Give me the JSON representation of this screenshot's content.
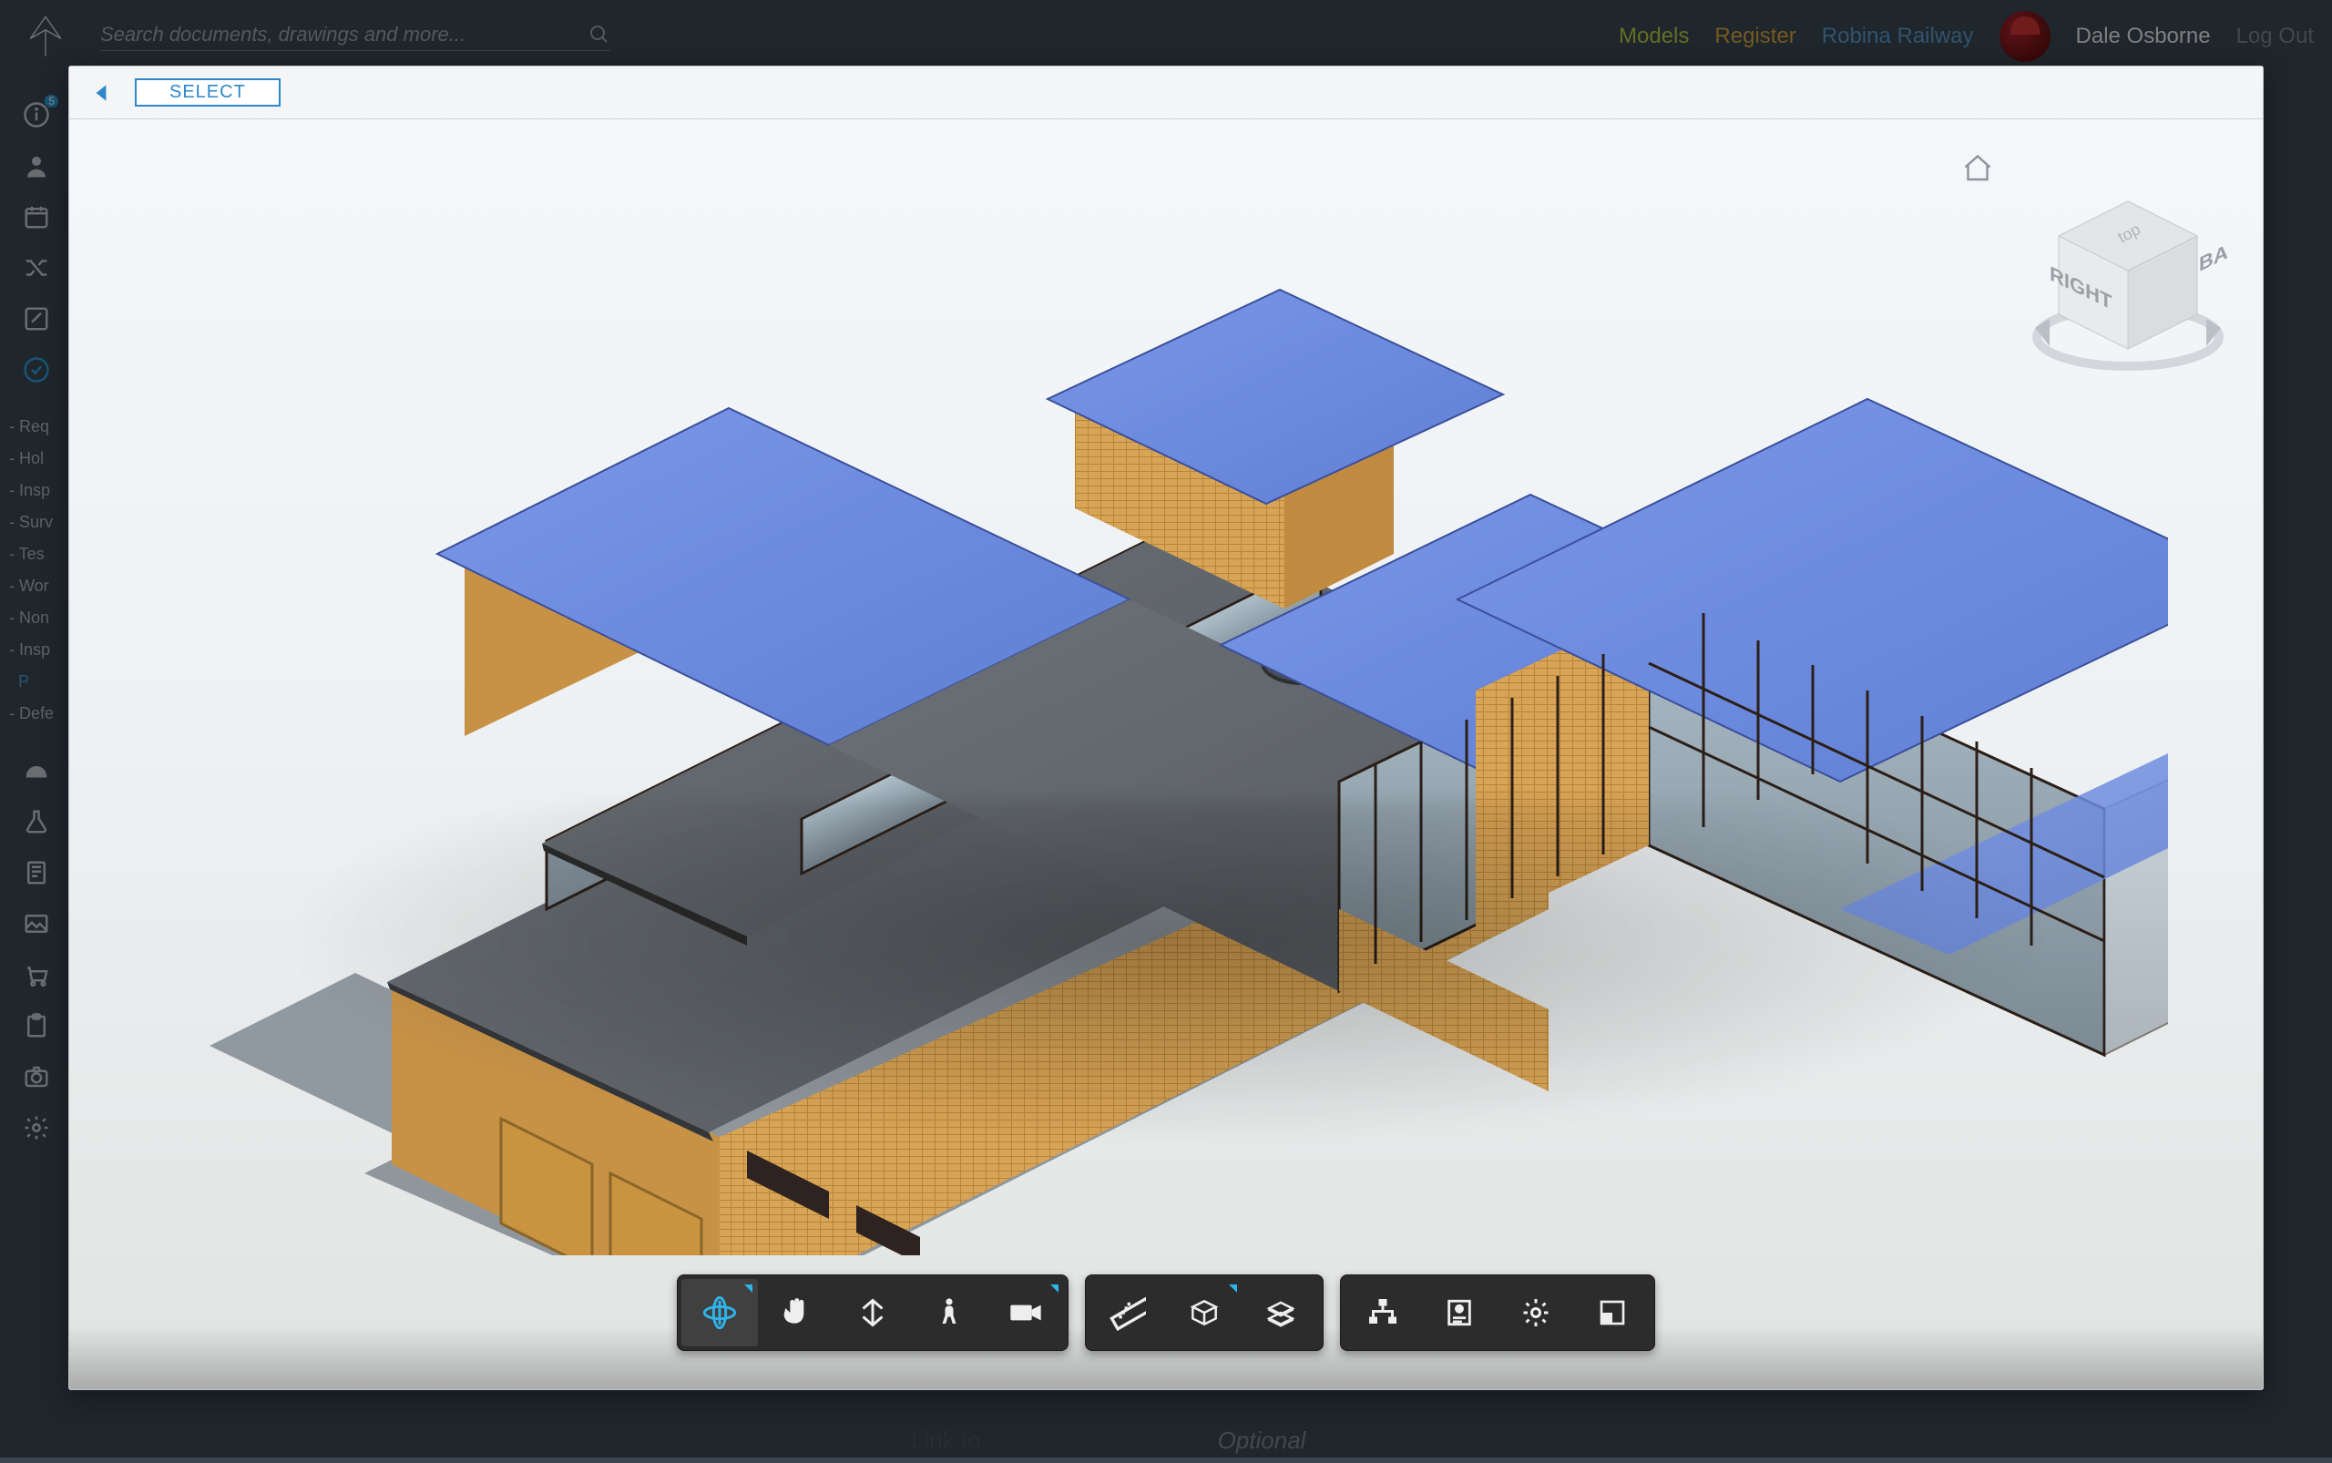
{
  "header": {
    "search_placeholder": "Search documents, drawings and more...",
    "nav_models": "Models",
    "nav_register": "Register",
    "nav_project": "Robina Railway",
    "user_name": "Dale Osborne",
    "logout": "Log Out"
  },
  "sidebar": {
    "badge_count": "5",
    "sub_items": [
      "- Req",
      "- Hol",
      "- Insp",
      "- Surv",
      "- Tes",
      "- Wor",
      "- Non",
      "- Insp",
      "  P",
      "- Defe"
    ],
    "sub_active_index": 8
  },
  "viewer": {
    "select_label": "SELECT",
    "viewcube": {
      "right": "RIGHT",
      "back": "BACK",
      "top": "top"
    }
  },
  "footer": {
    "label": "Link to",
    "value": "Optional"
  },
  "toolbar": {
    "group1": [
      {
        "name": "orbit",
        "active": true,
        "corner": true
      },
      {
        "name": "pan",
        "active": false,
        "corner": false
      },
      {
        "name": "zoom",
        "active": false,
        "corner": false
      },
      {
        "name": "walk",
        "active": false,
        "corner": false
      },
      {
        "name": "camera",
        "active": false,
        "corner": true
      }
    ],
    "group2": [
      {
        "name": "measure",
        "active": false,
        "corner": false
      },
      {
        "name": "section",
        "active": false,
        "corner": true
      },
      {
        "name": "explode",
        "active": false,
        "corner": false
      }
    ],
    "group3": [
      {
        "name": "model-tree",
        "active": false,
        "corner": false
      },
      {
        "name": "properties",
        "active": false,
        "corner": false
      },
      {
        "name": "settings",
        "active": false,
        "corner": false
      },
      {
        "name": "fullscreen",
        "active": false,
        "corner": false
      }
    ]
  }
}
